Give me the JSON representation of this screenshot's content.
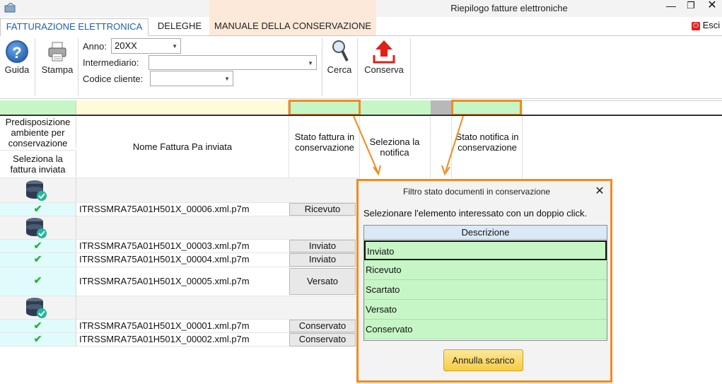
{
  "window": {
    "title": "Riepilogo fatture elettroniche",
    "minimize_glyph": "—",
    "maximize_glyph": "❐",
    "close_glyph": "✕"
  },
  "tabs": [
    {
      "label": "FATTURAZIONE ELETTRONICA",
      "active": true
    },
    {
      "label": "DELEGHE",
      "active": false
    },
    {
      "label": "MANUALE DELLA CONSERVAZIONE",
      "active": false
    }
  ],
  "exit": {
    "label": "Esci",
    "icon": "power-icon"
  },
  "ribbon": {
    "guida_label": "Guida",
    "stampa_label": "Stampa",
    "anno_label": "Anno:",
    "anno_value": "20XX",
    "intermediario_label": "Intermediario:",
    "intermediario_value": "",
    "codice_label": "Codice cliente:",
    "codice_value": "",
    "cerca_label": "Cerca",
    "conserva_label": "Conserva"
  },
  "columns": {
    "col1_top": "Predisposizione ambiente per conservazione",
    "col1_bottom": "Seleziona la fattura inviata",
    "col2": "Nome Fattura Pa inviata",
    "col3": "Stato fattura in conservazione",
    "col4": "Seleziona la notifica",
    "col6": "Stato notifica in conservazione"
  },
  "rows": {
    "r1": {
      "name": "ITRSSMRA75A01H501X_00006.xml.p7m",
      "state": "Ricevuto"
    },
    "r2": {
      "name": "ITRSSMRA75A01H501X_00003.xml.p7m",
      "state": "Inviato"
    },
    "r3": {
      "name": "ITRSSMRA75A01H501X_00004.xml.p7m",
      "state": "Inviato"
    },
    "r4": {
      "name": "ITRSSMRA75A01H501X_00005.xml.p7m",
      "state": "Versato"
    },
    "r5": {
      "name": "ITRSSMRA75A01H501X_00001.xml.p7m",
      "state": "Conservato"
    },
    "r6": {
      "name": "ITRSSMRA75A01H501X_00002.xml.p7m",
      "state": "Conservato"
    }
  },
  "dialog": {
    "title": "Filtro stato documenti in conservazione",
    "close_glyph": "✕",
    "instruction": "Selezionare l'elemento interessato con un doppio click.",
    "table_header": "Descrizione",
    "options": [
      "Inviato",
      "Ricevuto",
      "Scartato",
      "Versato",
      "Conservato"
    ],
    "selected": "Inviato",
    "cancel_label": "Annulla scarico"
  },
  "colors": {
    "accent_orange": "#f28a1f",
    "filter_green": "#c6f5c6",
    "tab_blue": "#1e5fa8"
  }
}
